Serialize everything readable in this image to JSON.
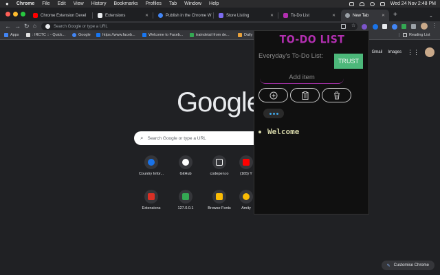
{
  "menubar": {
    "apple": "",
    "app": "Chrome",
    "items": [
      "File",
      "Edit",
      "View",
      "History",
      "Bookmarks",
      "Profiles",
      "Tab",
      "Window",
      "Help"
    ],
    "clock": "Wed 24 Nov  2:48 PM"
  },
  "tabs": [
    {
      "label": "Chrome Extension Devel",
      "icon": "youtube-icon",
      "color": "#ff0000"
    },
    {
      "label": "Extensions",
      "icon": "puzzle-icon",
      "color": "#e8eaed"
    },
    {
      "label": "Publish in the Chrome W",
      "icon": "chrome-icon",
      "color": "#4285f4"
    },
    {
      "label": "Store Listing",
      "icon": "store-icon",
      "color": "#7c6cf0"
    },
    {
      "label": "To-Do List",
      "icon": "todo-icon",
      "color": "#b22fb0"
    },
    {
      "label": "New Tab",
      "icon": "newtab-icon",
      "color": "#9aa0a6"
    }
  ],
  "omnibox": {
    "placeholder": "Search Google or type a URL"
  },
  "bookmarks": {
    "apps": "Apps",
    "items": [
      {
        "label": ": IRCTC :: - Quick...",
        "color": "#e0e0e0"
      },
      {
        "label": "Google",
        "color": "#4285f4"
      },
      {
        "label": "https://www.faceb...",
        "color": "#1877f2"
      },
      {
        "label": "Welcome to Faceb...",
        "color": "#1877f2"
      },
      {
        "label": "traindetail from de...",
        "color": "#34a853"
      },
      {
        "label": "Daily",
        "color": "#e8a13b"
      }
    ],
    "reading_list": "Reading List"
  },
  "ntp": {
    "gmail": "Gmail",
    "images": "Images",
    "logo": "Google",
    "search_placeholder": "Search Google or type a URL",
    "shortcuts_row1": [
      {
        "label": "Country Infor...",
        "color": "#1a73e8"
      },
      {
        "label": "GitHub",
        "color": "#ffffff"
      },
      {
        "label": "codepen.io",
        "color": "#ffffff"
      },
      {
        "label": "(165) Y",
        "color": "#ff0000"
      }
    ],
    "shortcuts_row2": [
      {
        "label": "Extensions",
        "color": "#d93025"
      },
      {
        "label": "127.0.0.1",
        "color": "#34a853"
      },
      {
        "label": "Browse Fonts",
        "color": "#fbbc04"
      },
      {
        "label": "Amity",
        "color": "#fbbc04"
      }
    ],
    "customise": "Customise Chrome"
  },
  "popup": {
    "title": "TO-DO LIST",
    "list_name": "Everyday's To-Do List:",
    "trust_button": "TRUST",
    "add_placeholder": "Add item",
    "todos": [
      "Welcome"
    ]
  },
  "colors": {
    "accent_purple": "#b22fb0",
    "trust_green": "#4cb87a",
    "todo_text": "#d6d6a8"
  }
}
